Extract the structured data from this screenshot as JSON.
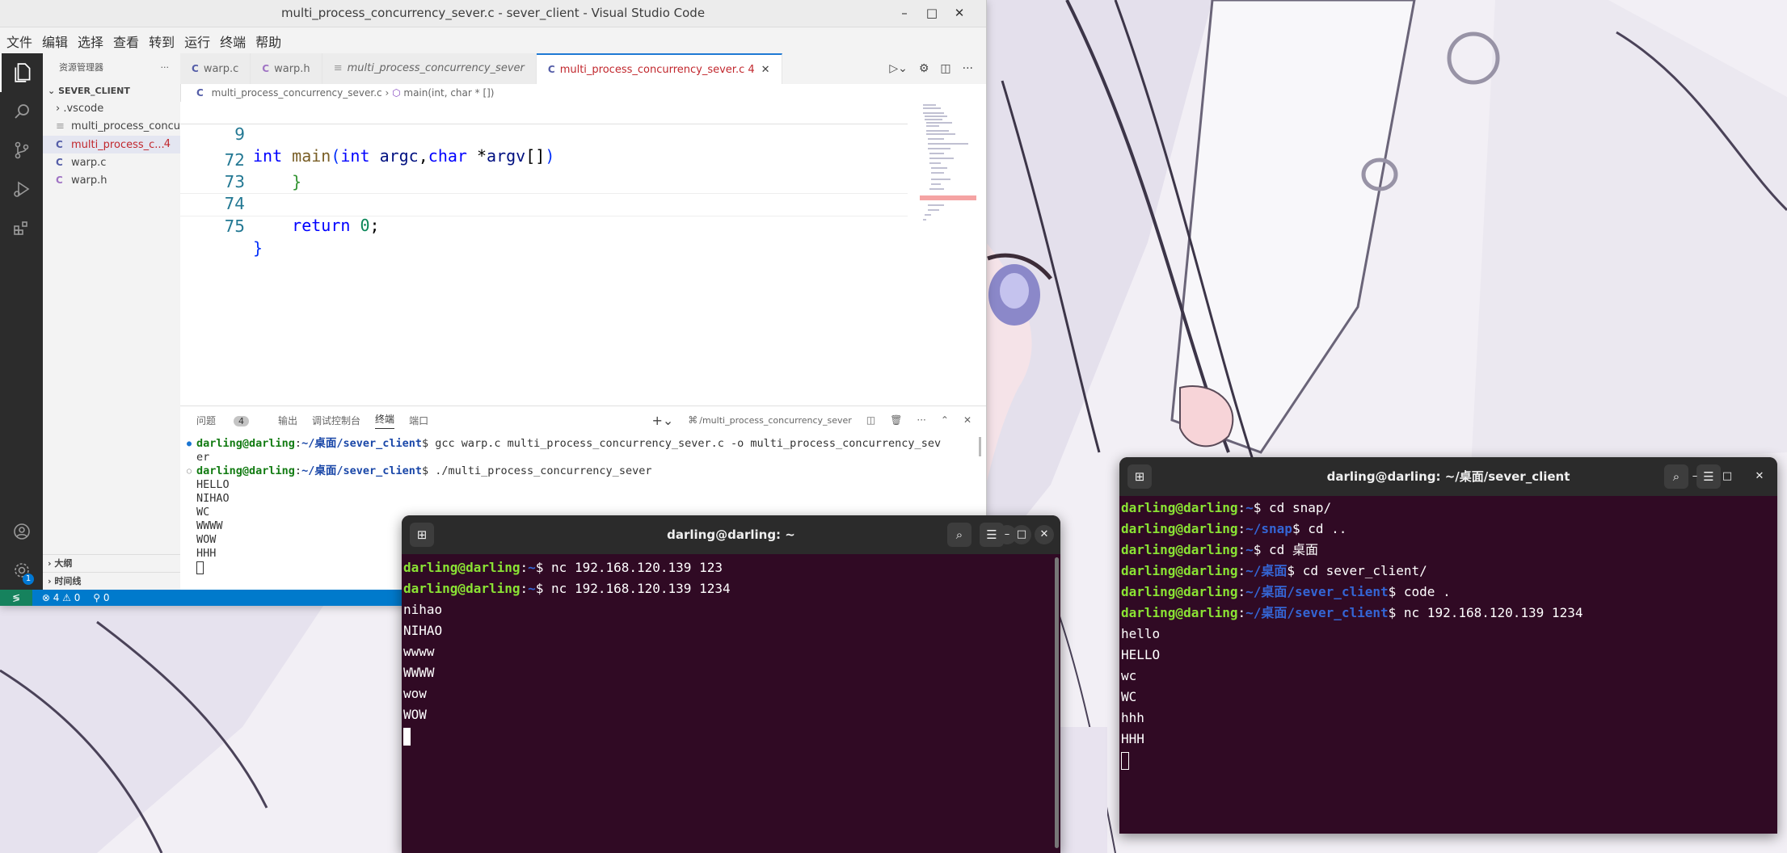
{
  "vscode": {
    "title": "multi_process_concurrency_sever.c - sever_client - Visual Studio Code",
    "menu": [
      "文件",
      "编辑",
      "选择",
      "查看",
      "转到",
      "运行",
      "终端",
      "帮助"
    ],
    "explorer": {
      "header": "资源管理器",
      "root": "SEVER_CLIENT",
      "items": [
        {
          "label": ".vscode",
          "type": "folder"
        },
        {
          "label": "multi_process_concu...",
          "type": "file"
        },
        {
          "label": "multi_process_c...",
          "type": "c",
          "badge": "4"
        },
        {
          "label": "warp.c",
          "type": "c"
        },
        {
          "label": "warp.h",
          "type": "c"
        }
      ],
      "outline": "大纲",
      "timeline": "时间线"
    },
    "tabs": [
      {
        "label": "warp.c",
        "active": false
      },
      {
        "label": "warp.h",
        "active": false
      },
      {
        "label": "multi_process_concurrency_sever",
        "active": false
      },
      {
        "label": "multi_process_concurrency_sever.c",
        "badge": "4",
        "active": true
      }
    ],
    "breadcrumb": {
      "file": "multi_process_concurrency_sever.c",
      "symbol": "main(int, char * [])"
    },
    "code_lines": [
      {
        "num": "9",
        "text": "int main(int argc,char *argv[])"
      },
      {
        "num": "72",
        "text": "    }"
      },
      {
        "num": "73",
        "text": ""
      },
      {
        "num": "74",
        "text": "    return 0;"
      },
      {
        "num": "75",
        "text": "}"
      }
    ],
    "panel": {
      "tabs": [
        "问题",
        "输出",
        "调试控制台",
        "终端",
        "端口"
      ],
      "problems_badge": "4",
      "active_tab": "终端",
      "terminal_name": "/multi_process_concurrency_sever",
      "lines": [
        {
          "user": "darling@darling",
          "path": "~/桌面/sever_client",
          "cmd": "$ gcc warp.c multi_process_concurrency_sever.c -o multi_process_concurrency_sev"
        },
        {
          "text": "er"
        },
        {
          "user": "darling@darling",
          "path": "~/桌面/sever_client",
          "cmd": "$ ./multi_process_concurrency_sever"
        },
        {
          "text": "HELLO"
        },
        {
          "text": "NIHAO"
        },
        {
          "text": "WC"
        },
        {
          "text": "WWWW"
        },
        {
          "text": "WOW"
        },
        {
          "text": "HHH"
        }
      ]
    },
    "status": {
      "errors": "4",
      "warnings": "0",
      "ports": "0",
      "settings_badge": "1"
    }
  },
  "terminal_home": {
    "title": "darling@darling: ~",
    "lines": [
      {
        "user": "darling@darling",
        "path": "~",
        "cmd": "$ nc 192.168.120.139 123"
      },
      {
        "user": "darling@darling",
        "path": "~",
        "cmd": "$ nc 192.168.120.139 1234"
      },
      {
        "text": "nihao"
      },
      {
        "text": "NIHAO"
      },
      {
        "text": "wwww"
      },
      {
        "text": "WWWW"
      },
      {
        "text": "wow"
      },
      {
        "text": "WOW"
      }
    ]
  },
  "terminal_client": {
    "title": "darling@darling: ~/桌面/sever_client",
    "lines": [
      {
        "user": "darling@darling",
        "path": "~",
        "cmd": "$ cd snap/"
      },
      {
        "user": "darling@darling",
        "path": "~/snap",
        "cmd": "$ cd .."
      },
      {
        "user": "darling@darling",
        "path": "~",
        "cmd": "$ cd 桌面"
      },
      {
        "user": "darling@darling",
        "path": "~/桌面",
        "cmd": "$ cd sever_client/"
      },
      {
        "user": "darling@darling",
        "path": "~/桌面/sever_client",
        "cmd": "$ code ."
      },
      {
        "user": "darling@darling",
        "path": "~/桌面/sever_client",
        "cmd": "$ nc 192.168.120.139 1234"
      },
      {
        "text": "hello"
      },
      {
        "text": "HELLO"
      },
      {
        "text": "wc"
      },
      {
        "text": "WC"
      },
      {
        "text": "hhh"
      },
      {
        "text": "HHH"
      }
    ]
  }
}
